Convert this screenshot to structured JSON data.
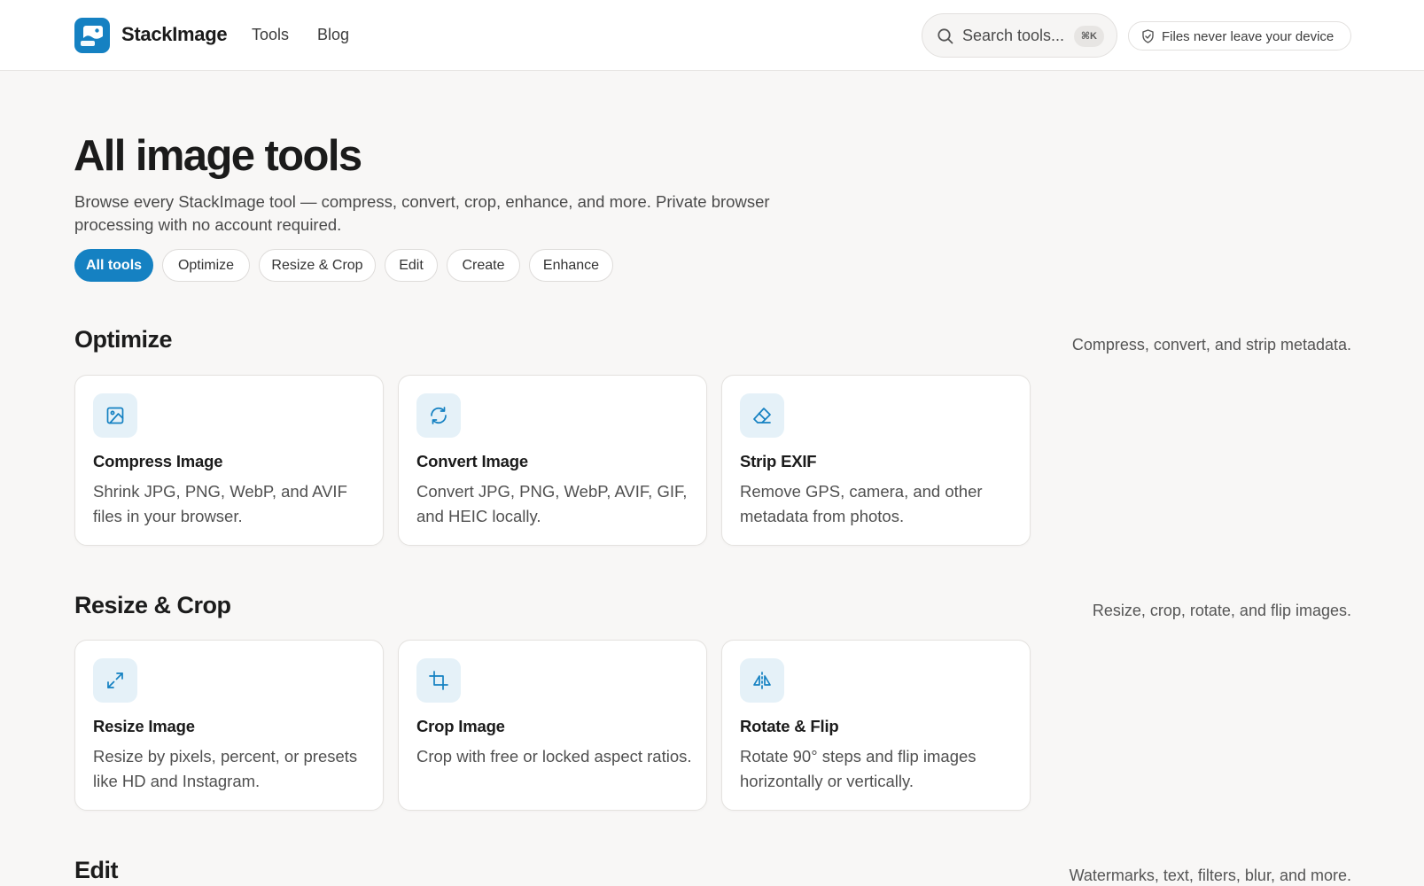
{
  "header": {
    "brand": "StackImage",
    "nav": [
      "Tools",
      "Blog"
    ],
    "search_placeholder": "Search tools...",
    "search_shortcut": "⌘K",
    "privacy_badge": "Files never leave your device"
  },
  "hero": {
    "title": "All image tools",
    "subtitle": "Browse every StackImage tool — compress, convert, crop, enhance, and more. Private browser processing with no account required."
  },
  "filters": [
    {
      "label": "All tools",
      "active": true
    },
    {
      "label": "Optimize",
      "active": false
    },
    {
      "label": "Resize & Crop",
      "active": false
    },
    {
      "label": "Edit",
      "active": false
    },
    {
      "label": "Create",
      "active": false
    },
    {
      "label": "Enhance",
      "active": false
    }
  ],
  "sections": [
    {
      "title": "Optimize",
      "description": "Compress, convert, and strip metadata.",
      "tools": [
        {
          "icon": "image-compress-icon",
          "title": "Compress Image",
          "description": "Shrink JPG, PNG, WebP, and AVIF files in your browser."
        },
        {
          "icon": "refresh-convert-icon",
          "title": "Convert Image",
          "description": "Convert JPG, PNG, WebP, AVIF, GIF, and HEIC locally."
        },
        {
          "icon": "eraser-icon",
          "title": "Strip EXIF",
          "description": "Remove GPS, camera, and other metadata from photos."
        }
      ]
    },
    {
      "title": "Resize & Crop",
      "description": "Resize, crop, rotate, and flip images.",
      "tools": [
        {
          "icon": "expand-arrows-icon",
          "title": "Resize Image",
          "description": "Resize by pixels, percent, or presets like HD and Instagram."
        },
        {
          "icon": "crop-icon",
          "title": "Crop Image",
          "description": "Crop with free or locked aspect ratios."
        },
        {
          "icon": "flip-horizontal-icon",
          "title": "Rotate & Flip",
          "description": "Rotate 90° steps and flip images horizontally or vertically."
        }
      ]
    },
    {
      "title": "Edit",
      "description": "Watermarks, text, filters, blur, and more.",
      "tools": []
    }
  ],
  "colors": {
    "accent": "#1581c2",
    "icon_bg": "#e5f1f8",
    "page_bg": "#f8f7f6"
  }
}
